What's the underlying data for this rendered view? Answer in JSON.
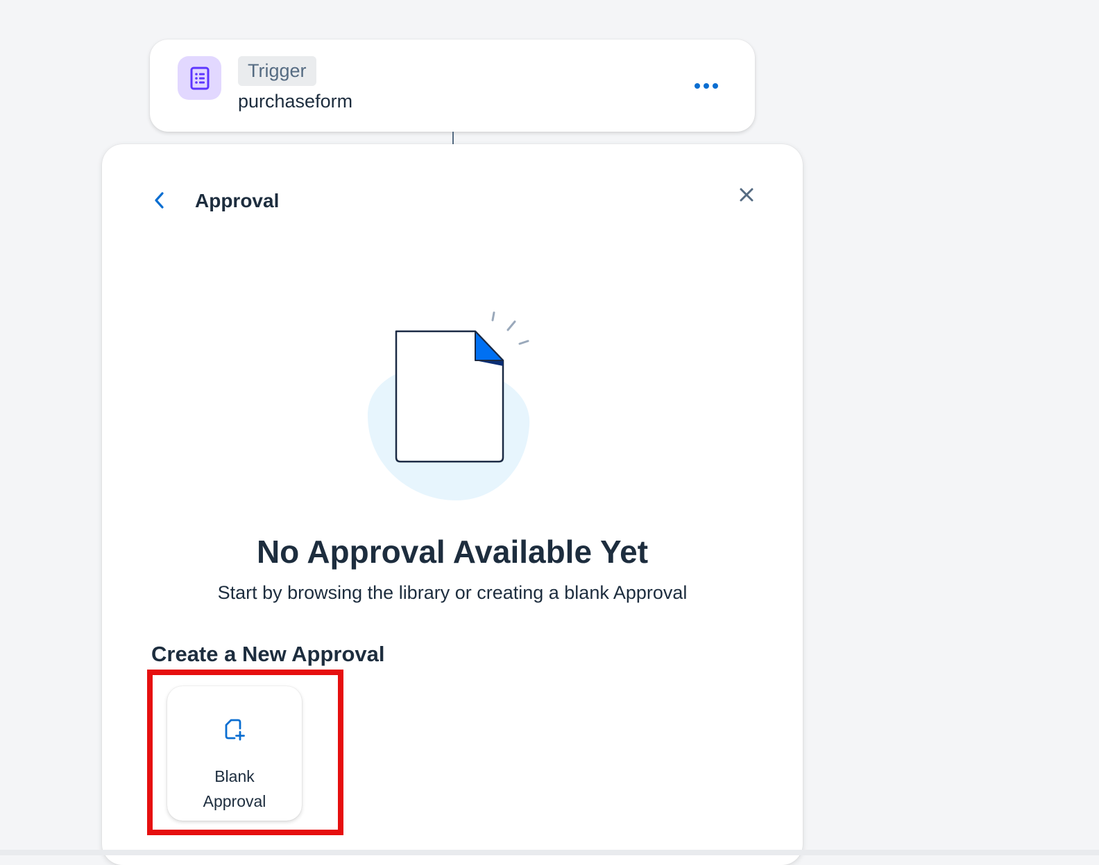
{
  "trigger": {
    "badge_label": "Trigger",
    "name": "purchaseform",
    "icon": "form-icon",
    "more_icon": "more-horizontal-icon"
  },
  "panel": {
    "title": "Approval",
    "back_icon": "chevron-left-icon",
    "close_icon": "close-icon"
  },
  "empty_state": {
    "illustration": "empty-document-illustration",
    "title": "No Approval Available Yet",
    "subtitle": "Start by browsing the library or creating a blank Approval"
  },
  "create_section": {
    "title": "Create a New Approval",
    "options": [
      {
        "label": "Blank\nApproval",
        "icon": "add-document-icon"
      }
    ]
  },
  "colors": {
    "accent": "#0a6ed1",
    "trigger_icon_bg": "#e2d8ff",
    "trigger_icon": "#5d36ff",
    "highlight": "#e60f0f",
    "text": "#1d2d3e"
  }
}
